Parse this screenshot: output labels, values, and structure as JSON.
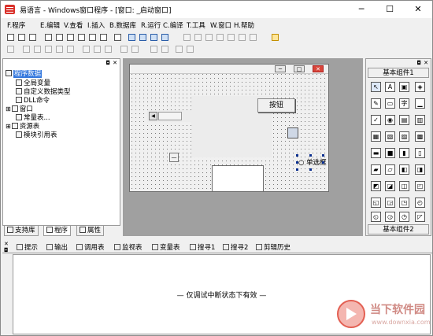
{
  "window": {
    "title": "易语言 - Windows窗口程序 - [窗口: _启动窗口]",
    "minimize": "─",
    "maximize": "☐",
    "close": "✕"
  },
  "menu": [
    "F.程序",
    "E.编辑",
    "V.查看",
    "I.插入",
    "B.数据库",
    "R.运行",
    "C.编译",
    "T.工具",
    "W.窗口",
    "H.帮助"
  ],
  "tree": {
    "root": "程序数据",
    "items": [
      "全局变量",
      "自定义数据类型",
      "DLL命令",
      "窗口",
      "常量表...",
      "资源表",
      "模块引用表"
    ]
  },
  "left_tabs": [
    "支持库",
    "程序",
    "属性"
  ],
  "form": {
    "button_label": "按钮",
    "radio_label": "单选框"
  },
  "palette": {
    "header1": "基本组件1",
    "header2": "基本组件2"
  },
  "bottom_tabs": [
    "提示",
    "输出",
    "调用表",
    "监视表",
    "变量表",
    "搜寻1",
    "搜寻2",
    "剪辑历史"
  ],
  "output_message": "— 仅调试中断状态下有效 —",
  "watermark": {
    "text": "当下软件园",
    "url": "www.downxia.com"
  }
}
